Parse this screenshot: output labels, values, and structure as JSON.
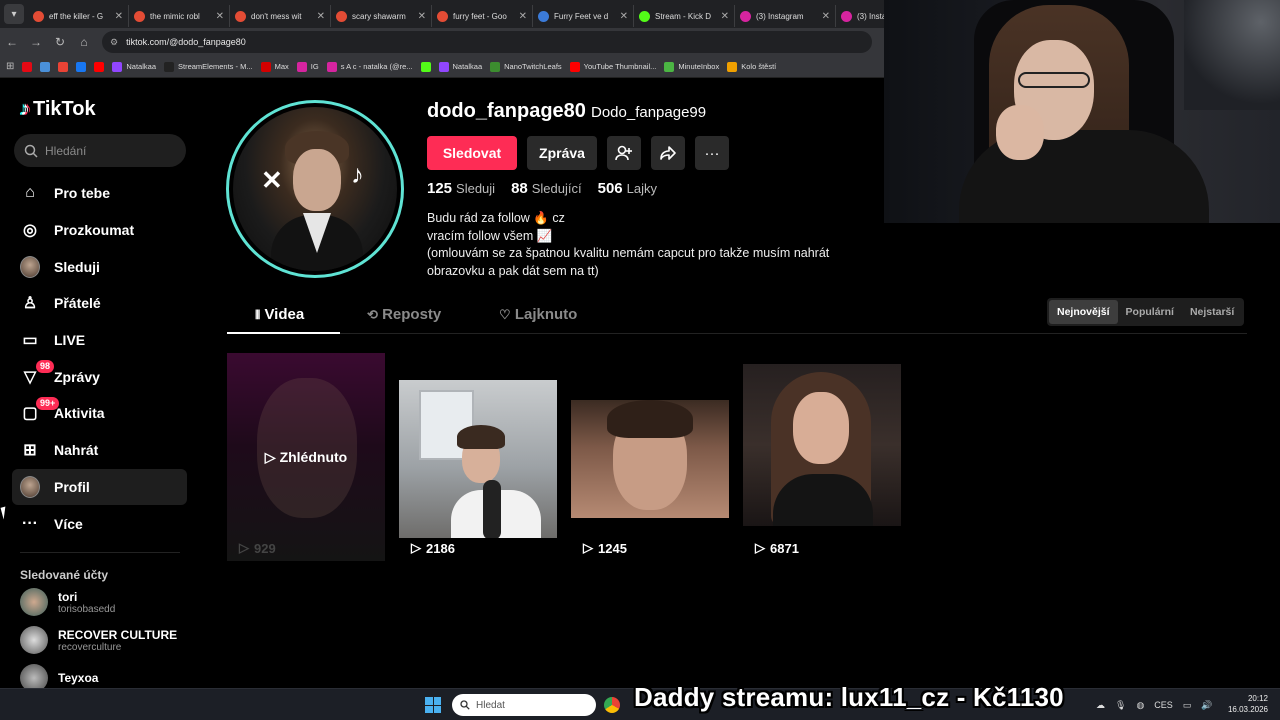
{
  "browser": {
    "tabs": [
      {
        "label": "eff the killer - G",
        "color": "#e34c35"
      },
      {
        "label": "the mimic robl",
        "color": "#e34c35"
      },
      {
        "label": "don't mess wit",
        "color": "#e34c35"
      },
      {
        "label": "scary shawarm",
        "color": "#e34c35"
      },
      {
        "label": "furry feet - Goo",
        "color": "#e34c35"
      },
      {
        "label": "Furry Feet ve d",
        "color": "#3b7bd9"
      },
      {
        "label": "Stream - Kick D",
        "color": "#53fc18"
      },
      {
        "label": "(3) Instagram",
        "color": "#d6249f"
      },
      {
        "label": "(3) Insta",
        "color": "#d6249f"
      }
    ],
    "url": "tiktok.com/@dodo_fanpage80",
    "bookmarks": [
      {
        "label": "",
        "color": "#e50914"
      },
      {
        "label": "",
        "color": "#4a90d9"
      },
      {
        "label": "",
        "color": "#ea4335"
      },
      {
        "label": "",
        "color": "#1877f2"
      },
      {
        "label": "",
        "color": "#ff0000"
      },
      {
        "label": "Natalkaa",
        "color": "#9146ff"
      },
      {
        "label": "StreamElements - M...",
        "color": "#222222"
      },
      {
        "label": "Max",
        "color": "#d40000"
      },
      {
        "label": "IG",
        "color": "#d6249f"
      },
      {
        "label": "s A c - natalka (@re...",
        "color": "#d6249f"
      },
      {
        "label": "",
        "color": "#53fc18"
      },
      {
        "label": "Natalkaa",
        "color": "#9146ff"
      },
      {
        "label": "NanoTwitchLeafs",
        "color": "#3c8d2f"
      },
      {
        "label": "YouTube Thumbnail...",
        "color": "#ff0000"
      },
      {
        "label": "MinuteInbox",
        "color": "#4bb543"
      },
      {
        "label": "Kolo štěstí",
        "color": "#f0a000"
      }
    ]
  },
  "sidebar": {
    "logo": "TikTok",
    "search_placeholder": "Hledání",
    "items": [
      {
        "label": "Pro tebe",
        "icon": "home-icon",
        "glyph": "⌂"
      },
      {
        "label": "Prozkoumat",
        "icon": "compass-icon",
        "glyph": "◎"
      },
      {
        "label": "Sleduji",
        "icon": "following-avatar-icon",
        "glyph": ""
      },
      {
        "label": "Přátelé",
        "icon": "friends-icon",
        "glyph": "♙"
      },
      {
        "label": "LIVE",
        "icon": "live-tv-icon",
        "glyph": "▭"
      },
      {
        "label": "Zprávy",
        "icon": "messages-icon",
        "glyph": "▽",
        "badge": "98"
      },
      {
        "label": "Aktivita",
        "icon": "activity-icon",
        "glyph": "▢",
        "badge": "99+"
      },
      {
        "label": "Nahrát",
        "icon": "upload-plus-icon",
        "glyph": "⊞"
      },
      {
        "label": "Profil",
        "icon": "profile-avatar-icon",
        "glyph": ""
      },
      {
        "label": "Více",
        "icon": "more-dots-icon",
        "glyph": "···"
      }
    ],
    "following_title": "Sledované účty",
    "following": [
      {
        "name": "tori",
        "handle": "torisobasedd"
      },
      {
        "name": "RECOVER CULTURE",
        "handle": "recoverculture"
      },
      {
        "name": "Teyxoa",
        "handle": ""
      }
    ]
  },
  "profile": {
    "username": "dodo_fanpage80",
    "nickname": "Dodo_fanpage99",
    "follow_label": "Sledovat",
    "message_label": "Zpráva",
    "following_count": "125",
    "following_label": "Sleduji",
    "followers_count": "88",
    "followers_label": "Sledující",
    "likes_count": "506",
    "likes_label": "Lajky",
    "bio": [
      "Budu rád za follow 🔥 cz",
      "vracím follow všem 📈",
      "(omlouvám se za špatnou kvalitu nemám capcut pro takže musím nahrát",
      "obrazovku a pak dát sem na tt)"
    ]
  },
  "tabs": [
    {
      "label": "Videa",
      "icon": "grid-icon",
      "active": true
    },
    {
      "label": "Reposty",
      "icon": "repost-icon",
      "active": false
    },
    {
      "label": "Lajknuto",
      "icon": "liked-heart-icon",
      "active": false
    }
  ],
  "sort": [
    "Nejnovější",
    "Populární",
    "Nejstarší"
  ],
  "sort_active": "Nejnovější",
  "videos": [
    {
      "views": "929",
      "watched_label": "Zhlédnuto",
      "watched": true
    },
    {
      "views": "2186",
      "watched": false
    },
    {
      "views": "1245",
      "watched": false
    },
    {
      "views": "6871",
      "watched": false
    }
  ],
  "taskbar": {
    "search_placeholder": "Hledat",
    "language": "CES",
    "time": "20:12",
    "date": "16.03.2026"
  },
  "stream_overlay": "Daddy streamu: lux11_cz - Kč1130"
}
